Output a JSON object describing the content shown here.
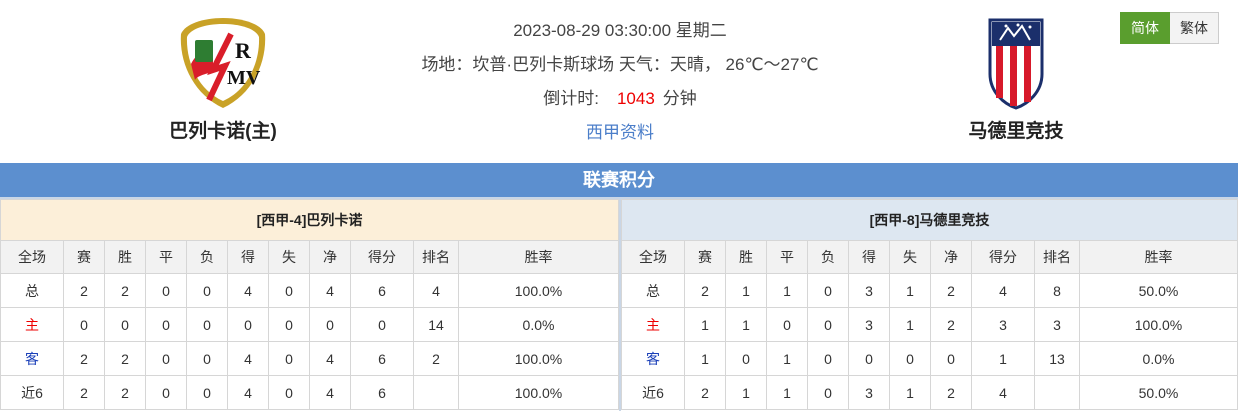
{
  "header": {
    "home_team": "巴列卡诺(主)",
    "away_team": "马德里竞技",
    "datetime": "2023-08-29 03:30:00 星期二",
    "venue_weather": "场地：坎普·巴列卡斯球场 天气：天晴， 26℃～27℃",
    "countdown_label": "倒计时:",
    "countdown_value": "1043",
    "countdown_unit": "分钟",
    "league_link": "西甲资料",
    "home_logo_text": "RM",
    "colors": {
      "home_red": "#d91e2a",
      "home_gold": "#c9a227",
      "away_navy": "#1b2f6b",
      "away_red": "#d7192a"
    }
  },
  "lang": {
    "simplified": "简体",
    "traditional": "繁体"
  },
  "banner": "联赛积分",
  "standings": {
    "columns": [
      "全场",
      "赛",
      "胜",
      "平",
      "负",
      "得",
      "失",
      "净",
      "得分",
      "排名",
      "胜率"
    ],
    "home": {
      "title": "[西甲-4]巴列卡诺",
      "rows": [
        [
          "总",
          "2",
          "2",
          "0",
          "0",
          "4",
          "0",
          "4",
          "6",
          "4",
          "100.0%"
        ],
        [
          "主",
          "0",
          "0",
          "0",
          "0",
          "0",
          "0",
          "0",
          "0",
          "14",
          "0.0%"
        ],
        [
          "客",
          "2",
          "2",
          "0",
          "0",
          "4",
          "0",
          "4",
          "6",
          "2",
          "100.0%"
        ],
        [
          "近6",
          "2",
          "2",
          "0",
          "0",
          "4",
          "0",
          "4",
          "6",
          "",
          "100.0%"
        ]
      ]
    },
    "away": {
      "title": "[西甲-8]马德里竞技",
      "rows": [
        [
          "总",
          "2",
          "1",
          "1",
          "0",
          "3",
          "1",
          "2",
          "4",
          "8",
          "50.0%"
        ],
        [
          "主",
          "1",
          "1",
          "0",
          "0",
          "3",
          "1",
          "2",
          "3",
          "3",
          "100.0%"
        ],
        [
          "客",
          "1",
          "0",
          "1",
          "0",
          "0",
          "0",
          "0",
          "1",
          "13",
          "0.0%"
        ],
        [
          "近6",
          "2",
          "1",
          "1",
          "0",
          "3",
          "1",
          "2",
          "4",
          "",
          "50.0%"
        ]
      ]
    }
  }
}
